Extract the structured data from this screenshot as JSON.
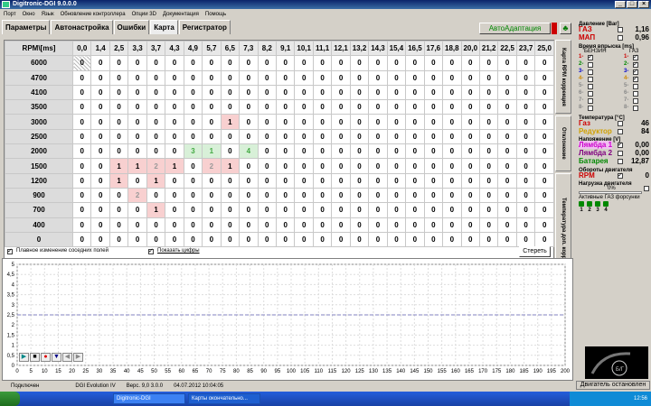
{
  "window": {
    "title": "Digitronic-DGI  9.0.0.0"
  },
  "menu": [
    "Порт",
    "Окно",
    "Язык",
    "Обновление контроллера",
    "Опции 3D",
    "Документация",
    "Помощь"
  ],
  "tabs": [
    "Параметры",
    "Автонастройка",
    "Ошибки",
    "Карта",
    "Регистратор"
  ],
  "toolbar": {
    "auto_label": "АвтоАдаптация"
  },
  "map": {
    "corner": "RPM\\[ms]",
    "cols": [
      "0,0",
      "1,4",
      "2,5",
      "3,3",
      "3,7",
      "4,3",
      "4,9",
      "5,7",
      "6,5",
      "7,3",
      "8,2",
      "9,1",
      "10,1",
      "11,1",
      "12,1",
      "13,2",
      "14,3",
      "15,4",
      "16,5",
      "17,6",
      "18,8",
      "20,0",
      "21,2",
      "22,5",
      "23,7",
      "25,0"
    ],
    "rows": [
      {
        "rpm": "6000",
        "cells": [
          "0",
          "0",
          "0",
          "0",
          "0",
          "0",
          "0",
          "0",
          "0",
          "0",
          "0",
          "0",
          "0",
          "0",
          "0",
          "0",
          "0",
          "0",
          "0",
          "0",
          "0",
          "0",
          "0",
          "0",
          "0",
          "0"
        ]
      },
      {
        "rpm": "4700",
        "cells": [
          "0",
          "0",
          "0",
          "0",
          "0",
          "0",
          "0",
          "0",
          "0",
          "0",
          "0",
          "0",
          "0",
          "0",
          "0",
          "0",
          "0",
          "0",
          "0",
          "0",
          "0",
          "0",
          "0",
          "0",
          "0",
          "0"
        ]
      },
      {
        "rpm": "4100",
        "cells": [
          "0",
          "0",
          "0",
          "0",
          "0",
          "0",
          "0",
          "0",
          "0",
          "0",
          "0",
          "0",
          "0",
          "0",
          "0",
          "0",
          "0",
          "0",
          "0",
          "0",
          "0",
          "0",
          "0",
          "0",
          "0",
          "0"
        ]
      },
      {
        "rpm": "3500",
        "cells": [
          "0",
          "0",
          "0",
          "0",
          "0",
          "0",
          "0",
          "0",
          "0",
          "0",
          "0",
          "0",
          "0",
          "0",
          "0",
          "0",
          "0",
          "0",
          "0",
          "0",
          "0",
          "0",
          "0",
          "0",
          "0",
          "0"
        ]
      },
      {
        "rpm": "3000",
        "cells": [
          "0",
          "0",
          "0",
          "0",
          "0",
          "0",
          "0",
          "0",
          "1",
          "0",
          "0",
          "0",
          "0",
          "0",
          "0",
          "0",
          "0",
          "0",
          "0",
          "0",
          "0",
          "0",
          "0",
          "0",
          "0",
          "0"
        ]
      },
      {
        "rpm": "2500",
        "cells": [
          "0",
          "0",
          "0",
          "0",
          "0",
          "0",
          "0",
          "0",
          "0",
          "0",
          "0",
          "0",
          "0",
          "0",
          "0",
          "0",
          "0",
          "0",
          "0",
          "0",
          "0",
          "0",
          "0",
          "0",
          "0",
          "0"
        ]
      },
      {
        "rpm": "2000",
        "cells": [
          "0",
          "0",
          "0",
          "0",
          "0",
          "0",
          "-3",
          "-1",
          "0",
          "-4",
          "0",
          "0",
          "0",
          "0",
          "0",
          "0",
          "0",
          "0",
          "0",
          "0",
          "0",
          "0",
          "0",
          "0",
          "0",
          "0"
        ]
      },
      {
        "rpm": "1500",
        "cells": [
          "0",
          "0",
          "1",
          "1",
          "2",
          "1",
          "0",
          "2",
          "1",
          "0",
          "0",
          "0",
          "0",
          "0",
          "0",
          "0",
          "0",
          "0",
          "0",
          "0",
          "0",
          "0",
          "0",
          "0",
          "0",
          "0"
        ]
      },
      {
        "rpm": "1200",
        "cells": [
          "0",
          "0",
          "1",
          "0",
          "1",
          "0",
          "0",
          "0",
          "0",
          "0",
          "0",
          "0",
          "0",
          "0",
          "0",
          "0",
          "0",
          "0",
          "0",
          "0",
          "0",
          "0",
          "0",
          "0",
          "0",
          "0"
        ]
      },
      {
        "rpm": "900",
        "cells": [
          "0",
          "0",
          "0",
          "2",
          "0",
          "0",
          "0",
          "0",
          "0",
          "0",
          "0",
          "0",
          "0",
          "0",
          "0",
          "0",
          "0",
          "0",
          "0",
          "0",
          "0",
          "0",
          "0",
          "0",
          "0",
          "0"
        ]
      },
      {
        "rpm": "700",
        "cells": [
          "0",
          "0",
          "0",
          "0",
          "1",
          "0",
          "0",
          "0",
          "0",
          "0",
          "0",
          "0",
          "0",
          "0",
          "0",
          "0",
          "0",
          "0",
          "0",
          "0",
          "0",
          "0",
          "0",
          "0",
          "0",
          "0"
        ]
      },
      {
        "rpm": "400",
        "cells": [
          "0",
          "0",
          "0",
          "0",
          "0",
          "0",
          "0",
          "0",
          "0",
          "0",
          "0",
          "0",
          "0",
          "0",
          "0",
          "0",
          "0",
          "0",
          "0",
          "0",
          "0",
          "0",
          "0",
          "0",
          "0",
          "0"
        ]
      },
      {
        "rpm": "0",
        "cells": [
          "0",
          "0",
          "0",
          "0",
          "0",
          "0",
          "0",
          "0",
          "0",
          "0",
          "0",
          "0",
          "0",
          "0",
          "0",
          "0",
          "0",
          "0",
          "0",
          "0",
          "0",
          "0",
          "0",
          "0",
          "0",
          "0"
        ]
      }
    ]
  },
  "options": {
    "smooth": "Плавное изменение соседних полей",
    "show_digits": "Показать цифры",
    "clear": "Стереть"
  },
  "side_tabs": [
    "Карта RPM коррекция",
    "Отклонение",
    "Температура доп. коррекция"
  ],
  "right": {
    "pressure_title": "Давление [Bar]",
    "gas_label": "ГАЗ",
    "gas_val": "1,16",
    "map_label": "МАП",
    "map_val": "0,96",
    "inj_title": "Время впрыска [ms]",
    "inj_benz": "БЕНЗИН",
    "inj_gas": "ГАЗ",
    "inj_rows": [
      "1",
      "2",
      "3",
      "4",
      "5",
      "6",
      "7",
      "8"
    ],
    "temp_title": "Температура [°C]",
    "t_gas_label": "Газ",
    "t_gas_val": "46",
    "t_red_label": "Редуктор",
    "t_red_val": "84",
    "volt_title": "Напряжение [V]",
    "l1_label": "Лямбда 1",
    "l1_val": "0,00",
    "l2_label": "Лямбда 2",
    "l2_val": "0,00",
    "bat_label": "Батарея",
    "bat_val": "12,87",
    "rpm_title": "Обороты двигателя",
    "rpm_label": "RPM",
    "rpm_val": "0",
    "load_title": "Нагрузка двигателя",
    "load_pct": "0%",
    "inj_active": "Активные ГАЗ форсунки",
    "inj_nums": [
      "1",
      "2",
      "3",
      "4"
    ]
  },
  "chart_data": {
    "type": "line",
    "y_ticks": [
      "5",
      "4,5",
      "4",
      "3,5",
      "3",
      "2,5",
      "2",
      "1,5",
      "1",
      "0,5",
      "0"
    ],
    "x_ticks": [
      "0",
      "5",
      "10",
      "15",
      "20",
      "25",
      "30",
      "35",
      "40",
      "45",
      "50",
      "55",
      "60",
      "65",
      "70",
      "75",
      "80",
      "85",
      "90",
      "95",
      "100",
      "105",
      "110",
      "115",
      "120",
      "125",
      "130",
      "135",
      "140",
      "145",
      "150",
      "155",
      "160",
      "165",
      "170",
      "175",
      "180",
      "185",
      "190",
      "195",
      "200"
    ],
    "ylim": [
      0,
      5
    ],
    "xlim": [
      0,
      200
    ],
    "series": [
      {
        "values_const": 2.5,
        "color": "#8080c0"
      }
    ]
  },
  "status": {
    "conn": "Подключен",
    "model": "DGI Evolution IV",
    "version": "Верс. 9,0  3.0.0",
    "date": "04.07.2012 10:04:05"
  },
  "engine_status": "Двигатель остановлен",
  "taskbar": {
    "item1": "Digitronic-DGI",
    "item2": "Карты окончательно...",
    "clock": "12:56"
  }
}
